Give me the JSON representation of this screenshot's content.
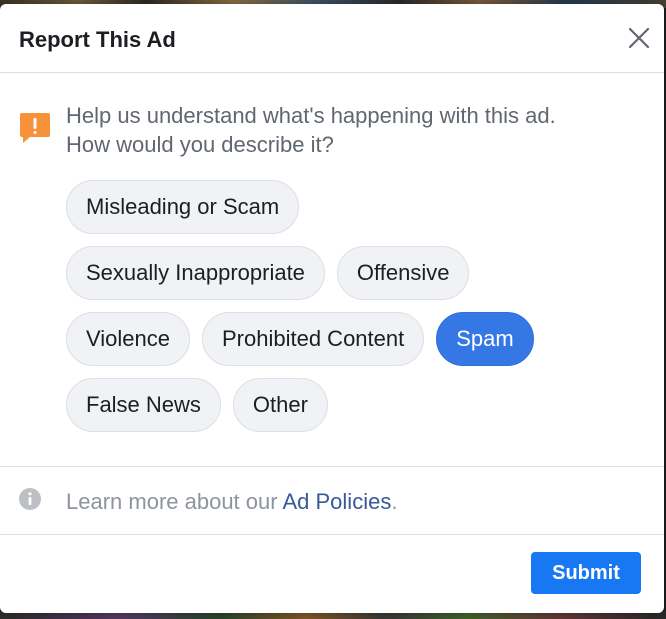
{
  "dialog": {
    "title": "Report This Ad",
    "close_icon": "close-icon"
  },
  "prompt": {
    "icon": "warning-speech-bubble-icon",
    "icon_color": "#f7923b",
    "line1": "Help us understand what's happening with this ad.",
    "line2": "How would you describe it?"
  },
  "options": {
    "row1": [
      {
        "label": "Misleading or Scam",
        "selected": false
      }
    ],
    "row2": [
      {
        "label": "Sexually Inappropriate",
        "selected": false
      },
      {
        "label": "Offensive",
        "selected": false
      }
    ],
    "row3": [
      {
        "label": "Violence",
        "selected": false
      },
      {
        "label": "Prohibited Content",
        "selected": false
      },
      {
        "label": "Spam",
        "selected": true
      }
    ],
    "row4": [
      {
        "label": "False News",
        "selected": false
      },
      {
        "label": "Other",
        "selected": false
      }
    ]
  },
  "footer": {
    "info_icon": "info-icon",
    "learn_prefix": "Learn more about our ",
    "learn_link": "Ad Policies",
    "learn_suffix": ".",
    "submit_label": "Submit"
  },
  "colors": {
    "accent": "#1877f2",
    "selected_chip": "#3578e5",
    "link": "#385898"
  }
}
